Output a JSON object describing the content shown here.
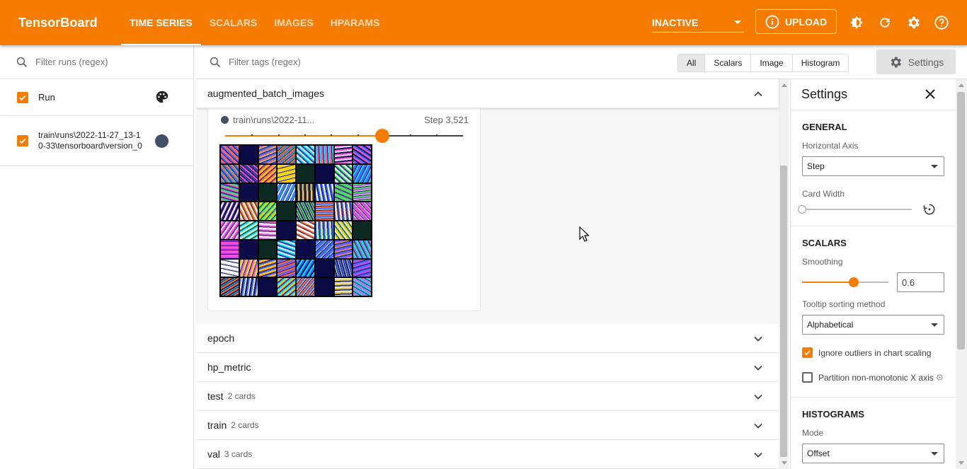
{
  "app": {
    "title": "TensorBoard"
  },
  "nav": {
    "tabs": [
      {
        "label": "TIME SERIES",
        "active": true
      },
      {
        "label": "SCALARS",
        "active": false
      },
      {
        "label": "IMAGES",
        "active": false
      },
      {
        "label": "HPARAMS",
        "active": false
      }
    ],
    "reload_status": "INACTIVE",
    "upload_label": "UPLOAD",
    "icons": [
      "info-icon",
      "theme-toggle-icon",
      "refresh-icon",
      "gear-icon",
      "help-icon"
    ]
  },
  "sidebar": {
    "filter_placeholder": "Filter runs (regex)",
    "run_header": "Run",
    "runs": [
      {
        "name": "train\\runs\\2022-11-27_13-10-33\\tensorboard\\version_0",
        "checked": true,
        "color": "#425066"
      }
    ]
  },
  "main": {
    "filter_placeholder": "Filter tags (regex)",
    "type_filters": [
      "All",
      "Scalars",
      "Image",
      "Histogram"
    ],
    "settings_button": "Settings",
    "expanded_group": {
      "name": "augmented_batch_images",
      "card": {
        "run_label": "train\\runs\\2022-11...",
        "step_label": "Step 3,521",
        "step_fraction": 0.66
      }
    },
    "groups": [
      {
        "name": "epoch",
        "count": ""
      },
      {
        "name": "hp_metric",
        "count": ""
      },
      {
        "name": "test",
        "count": "2 cards"
      },
      {
        "name": "train",
        "count": "2 cards"
      },
      {
        "name": "val",
        "count": "3 cards"
      }
    ]
  },
  "settings": {
    "title": "Settings",
    "general": {
      "title": "GENERAL",
      "horizontal_axis_label": "Horizontal Axis",
      "horizontal_axis_value": "Step",
      "card_width_label": "Card Width",
      "card_width_fraction": 0
    },
    "scalars": {
      "title": "SCALARS",
      "smoothing_label": "Smoothing",
      "smoothing_value": "0.6",
      "tooltip_label": "Tooltip sorting method",
      "tooltip_value": "Alphabetical",
      "ignore_outliers_label": "Ignore outliers in chart scaling",
      "ignore_outliers_checked": true,
      "partition_label": "Partition non-monotonic X axis",
      "partition_checked": false
    },
    "histograms": {
      "title": "HISTOGRAMS",
      "mode_label": "Mode",
      "mode_value": "Offset"
    }
  },
  "colors": {
    "accent": "#f57c00",
    "run": "#425066"
  }
}
